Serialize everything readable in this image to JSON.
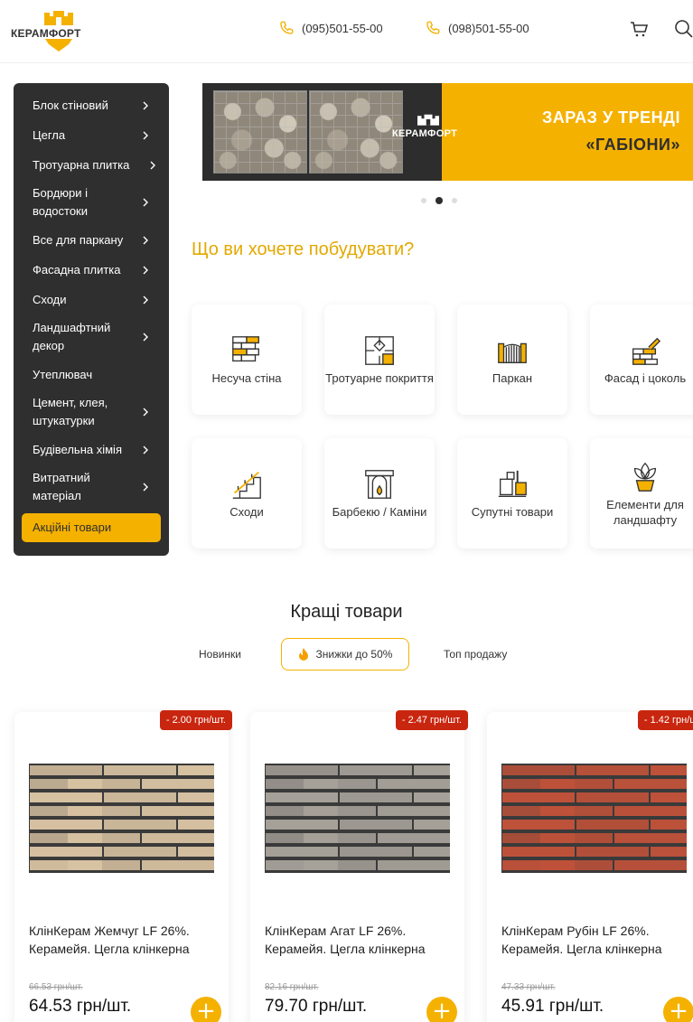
{
  "header": {
    "logo_text": "КЕРАМФОРТ",
    "phones": [
      "(095)501-55-00",
      "(098)501-55-00"
    ]
  },
  "sidebar": {
    "items": [
      {
        "label": "Блок стіновий",
        "arrow": true
      },
      {
        "label": "Цегла",
        "arrow": true
      },
      {
        "label": "Тротуарна плитка",
        "arrow": true
      },
      {
        "label": "Бордюри і водостоки",
        "arrow": true
      },
      {
        "label": "Все для паркану",
        "arrow": true
      },
      {
        "label": "Фасадна плитка",
        "arrow": true
      },
      {
        "label": "Сходи",
        "arrow": true
      },
      {
        "label": "Ландшафтний декор",
        "arrow": true
      },
      {
        "label": "Утеплювач",
        "arrow": false
      },
      {
        "label": "Цемент, клея, штукатурки",
        "arrow": true
      },
      {
        "label": "Будівельна хімія",
        "arrow": true
      },
      {
        "label": "Витратний матеріал",
        "arrow": true
      }
    ],
    "promo_label": "Акційні товари"
  },
  "banner": {
    "logo_text": "КЕРАМФОРТ",
    "title_line1": "ЗАРАЗ У ТРЕНДІ",
    "title_line2": "«ГАБІОНИ»",
    "active_slide": 2,
    "slide_count": 3
  },
  "build": {
    "title": "Що ви хочете побудувати?",
    "categories": [
      {
        "label": "Несуча стіна",
        "icon": "wall-icon"
      },
      {
        "label": "Тротуарне покриття",
        "icon": "paving-icon"
      },
      {
        "label": "Паркан",
        "icon": "fence-icon"
      },
      {
        "label": "Фасад і цоколь",
        "icon": "facade-icon"
      },
      {
        "label": "Сходи",
        "icon": "stairs-icon"
      },
      {
        "label": "Барбекю / Каміни",
        "icon": "fireplace-icon"
      },
      {
        "label": "Супутні товари",
        "icon": "tools-icon"
      },
      {
        "label": "Елементи для ландшафту",
        "icon": "plant-icon"
      }
    ]
  },
  "best": {
    "title": "Кращі товари",
    "tabs": {
      "new": "Новинки",
      "sale": "Знижки до 50%",
      "top": "Топ продажу"
    },
    "products": [
      {
        "badge": "- 2.00 грн/шт.",
        "name": "КлінКерам Жемчуг LF 26%. Керамейя. Цегла клінкерна",
        "old_price": "66.53 грн/шт.",
        "price": "64.53 грн/шт.",
        "color": "#d9c3a3"
      },
      {
        "badge": "- 2.47 грн/шт.",
        "name": "КлінКерам Агат LF 26%. Керамейя. Цегла клінкерна",
        "old_price": "82.16 грн/шт.",
        "price": "79.70 грн/шт.",
        "color": "#a7a29a"
      },
      {
        "badge": "- 1.42 грн/шт.",
        "name": "КлінКерам Рубін LF 26%. Керамейя. Цегла клінкерна",
        "old_price": "47.33 грн/шт.",
        "price": "45.91 грн/шт.",
        "color": "#c0523a"
      }
    ]
  },
  "colors": {
    "accent": "#f5b100",
    "dark": "#2f2f2f",
    "badge": "#c9260f"
  }
}
